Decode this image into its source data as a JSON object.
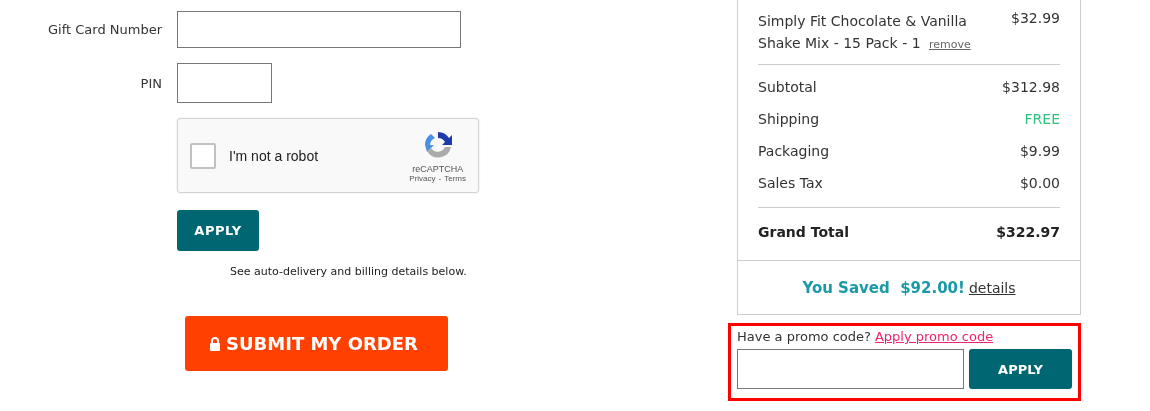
{
  "gift_card": {
    "number_label": "Gift Card Number",
    "pin_label": "PIN"
  },
  "captcha": {
    "label": "I'm not a robot",
    "checked": false,
    "brand": "reCAPTCHA",
    "privacy": "Privacy",
    "separator": "-",
    "terms": "Terms"
  },
  "apply_button": "APPLY",
  "note": "See auto-delivery and billing details below.",
  "submit_button": "SUBMIT MY ORDER",
  "order_item": {
    "name": "Simply Fit Chocolate & Vanilla Shake Mix - 15 Pack  - 1",
    "remove": "remove",
    "price": "$32.99"
  },
  "summary": [
    {
      "label": "Subtotal",
      "value": "$312.98",
      "kind": "amount"
    },
    {
      "label": "Shipping",
      "value": "FREE",
      "kind": "free"
    },
    {
      "label": "Packaging",
      "value": "$9.99",
      "kind": "amount"
    },
    {
      "label": "Sales Tax",
      "value": "$0.00",
      "kind": "amount"
    }
  ],
  "grand_total": {
    "label": "Grand Total",
    "value": "$322.97"
  },
  "savings": {
    "text": "You Saved  $92.00!",
    "link": "details"
  },
  "promo": {
    "question": "Have a promo code?",
    "link": "Apply promo code",
    "button": "APPLY"
  }
}
